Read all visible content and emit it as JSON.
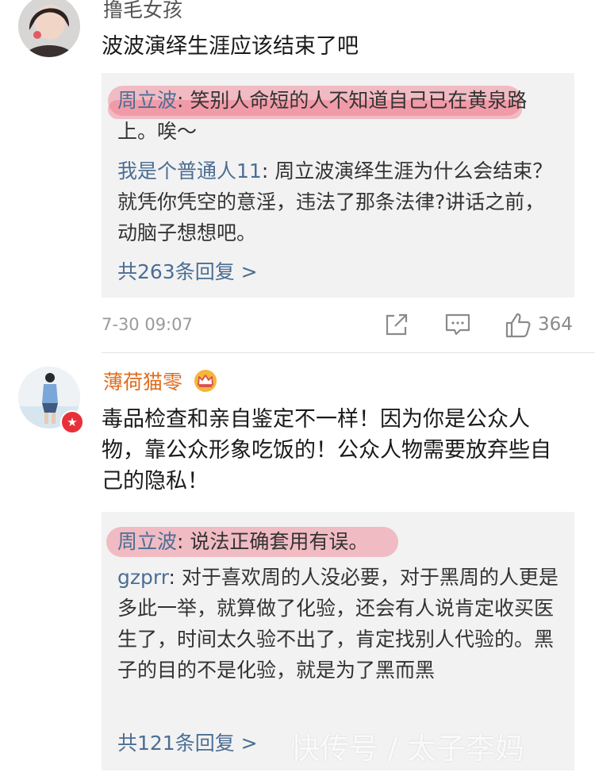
{
  "comments": [
    {
      "username": "撸毛女孩",
      "text": "波波演绎生涯应该结束了吧",
      "replies": [
        {
          "name": "周立波",
          "text": "笑别人命短的人不知道自己已在黄泉路上。唉～"
        },
        {
          "name": "我是个普通人11",
          "text": "周立波演绎生涯为什么会结束？就凭你凭空的意淫，违法了那条法律?讲话之前，动脑子想想吧。"
        }
      ],
      "more_replies": "共263条回复 >",
      "timestamp": "7-30 09:07",
      "likes": "364"
    },
    {
      "username": "薄荷猫零",
      "text": "毒品检查和亲自鉴定不一样！因为你是公众人物，靠公众形象吃饭的！公众人物需要放弃些自己的隐私！",
      "replies": [
        {
          "name": "周立波",
          "text": "说法正确套用有误。"
        },
        {
          "name": "gzprr",
          "text": "对于喜欢周的人没必要，对于黑周的人更是多此一举，就算做了化验，还会有人说肯定收买医生了，时间太久验不出了，肯定找别人代验的。黑子的目的不是化验，就是为了黑而黑"
        }
      ],
      "more_replies": "共121条回复 >"
    }
  ],
  "icons": {
    "share": "share-icon",
    "comment": "comment-icon",
    "like": "thumbs-up-icon",
    "crown": "crown-icon",
    "verified": "verified-badge-icon"
  },
  "colors": {
    "link_blue": "#4b6e94",
    "vip_orange": "#e06c1f",
    "highlight": "#f07082",
    "reply_bg": "#f2f2f2",
    "meta_gray": "#9a9a9a"
  },
  "watermark": "快传号 / 太子李妈"
}
